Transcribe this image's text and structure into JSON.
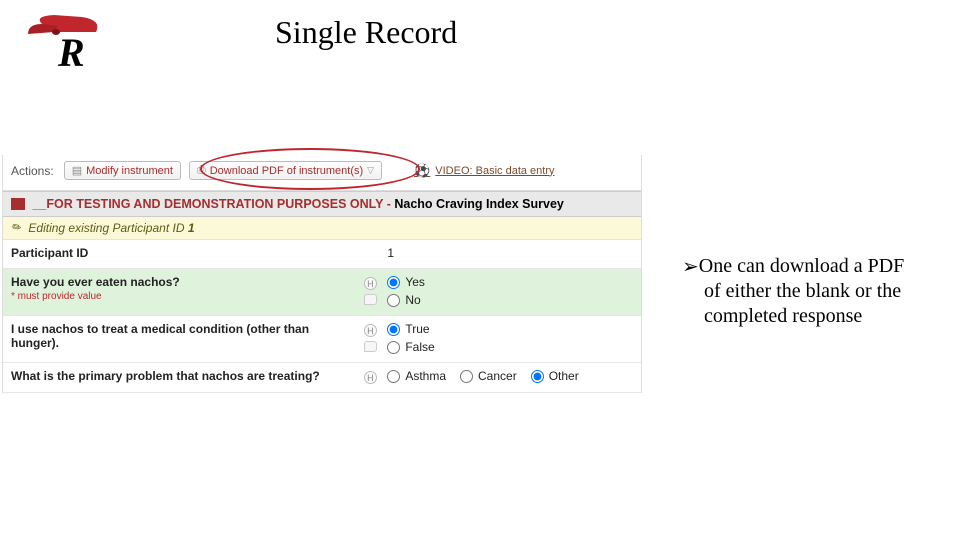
{
  "title": "Single Record",
  "actions": {
    "label": "Actions:",
    "modify": "Modify instrument",
    "download": "Download PDF of instrument(s)",
    "video": "VIDEO: Basic data entry"
  },
  "form": {
    "header_red": "__FOR TESTING AND DEMONSTRATION PURPOSES ONLY - ",
    "header_black": "Nacho Craving Index Survey",
    "editing_prefix": "Editing existing Participant ID ",
    "editing_id": "1",
    "required": "* must provide value",
    "q_pid": {
      "label": "Participant ID",
      "value": "1"
    },
    "q_eaten": {
      "label": "Have you ever eaten nachos?",
      "opts": [
        "Yes",
        "No"
      ],
      "selected": "Yes"
    },
    "q_med": {
      "label": "I use nachos to treat a medical condition (other than hunger).",
      "opts": [
        "True",
        "False"
      ],
      "selected": "True"
    },
    "q_prob": {
      "label": "What is the primary problem that nachos are treating?",
      "opts": [
        "Asthma",
        "Cancer",
        "Other"
      ],
      "selected": "Other"
    }
  },
  "note": {
    "l1": "One can download a PDF",
    "l2": "of either the blank or the",
    "l3": "completed response"
  }
}
